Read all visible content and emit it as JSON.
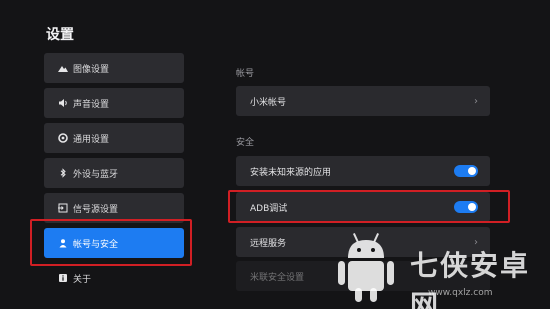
{
  "page_title": "设置",
  "sidebar": {
    "items": [
      {
        "label": "图像设置",
        "icon": "image-icon"
      },
      {
        "label": "声音设置",
        "icon": "speaker-icon"
      },
      {
        "label": "通用设置",
        "icon": "gear-icon"
      },
      {
        "label": "外设与蓝牙",
        "icon": "bluetooth-icon"
      },
      {
        "label": "信号源设置",
        "icon": "input-source-icon"
      },
      {
        "label": "帐号与安全",
        "icon": "user-icon",
        "active": true
      },
      {
        "label": "关于",
        "icon": "info-icon"
      }
    ]
  },
  "content": {
    "account_section": "帐号",
    "mi_account": "小米帐号",
    "security_section": "安全",
    "unknown_sources": {
      "label": "安装未知来源的应用",
      "enabled": true
    },
    "adb_debug": {
      "label": "ADB调试",
      "enabled": true
    },
    "remote_service": "远程服务",
    "mi_security": "米联安全设置"
  },
  "watermark": {
    "text": "七侠安卓网",
    "url": "www.qxlz.com"
  },
  "colors": {
    "background": "#141416",
    "accent": "#1d7cf2",
    "highlight_border": "#d11f24"
  }
}
